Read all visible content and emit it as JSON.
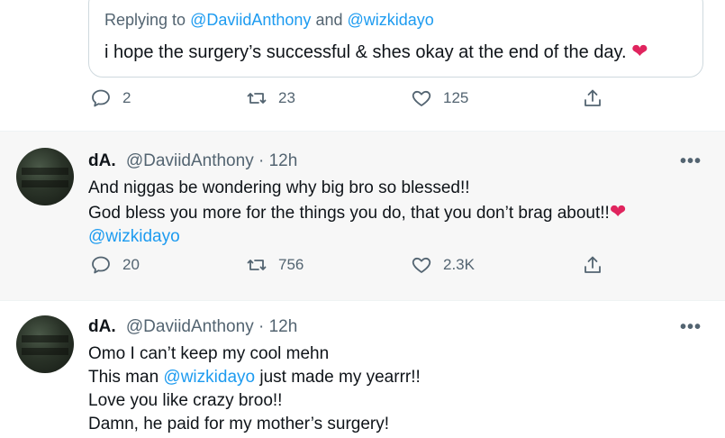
{
  "quoted": {
    "top_cut_text": "",
    "replying_prefix": "Replying to",
    "replying_user1": "@DaviidAnthony",
    "replying_and": "and",
    "replying_user2": "@wizkidayo",
    "text": "i hope the surgery’s successful & shes okay at the end of the day."
  },
  "top_actions": {
    "replies": "2",
    "retweets": "23",
    "likes": "125"
  },
  "tweets": [
    {
      "name": "dA.",
      "handle": "@DaviidAnthony",
      "time": "· 12h",
      "lines": [
        "And niggas be wondering why big bro so blessed!!",
        "God bless you more for the things you do, that you don’t brag about!!",
        "@wizkidayo"
      ],
      "actions": {
        "replies": "20",
        "retweets": "756",
        "likes": "2.3K"
      }
    },
    {
      "name": "dA.",
      "handle": "@DaviidAnthony",
      "time": "· 12h",
      "lines": [
        "Omo I can’t keep my cool mehn",
        "This man",
        "@wizkidayo",
        "just made my yearrr!!",
        "Love you like crazy broo!!",
        "Damn, he paid for my mother’s surgery!"
      ]
    }
  ],
  "more_label": "•••",
  "colors": {
    "heart": "#e0245e",
    "link": "#1d9bf0",
    "muted": "#536471"
  },
  "icons": {
    "reply": "reply-icon",
    "retweet": "retweet-icon",
    "like": "heart-icon",
    "share": "share-icon",
    "more": "more-icon"
  }
}
